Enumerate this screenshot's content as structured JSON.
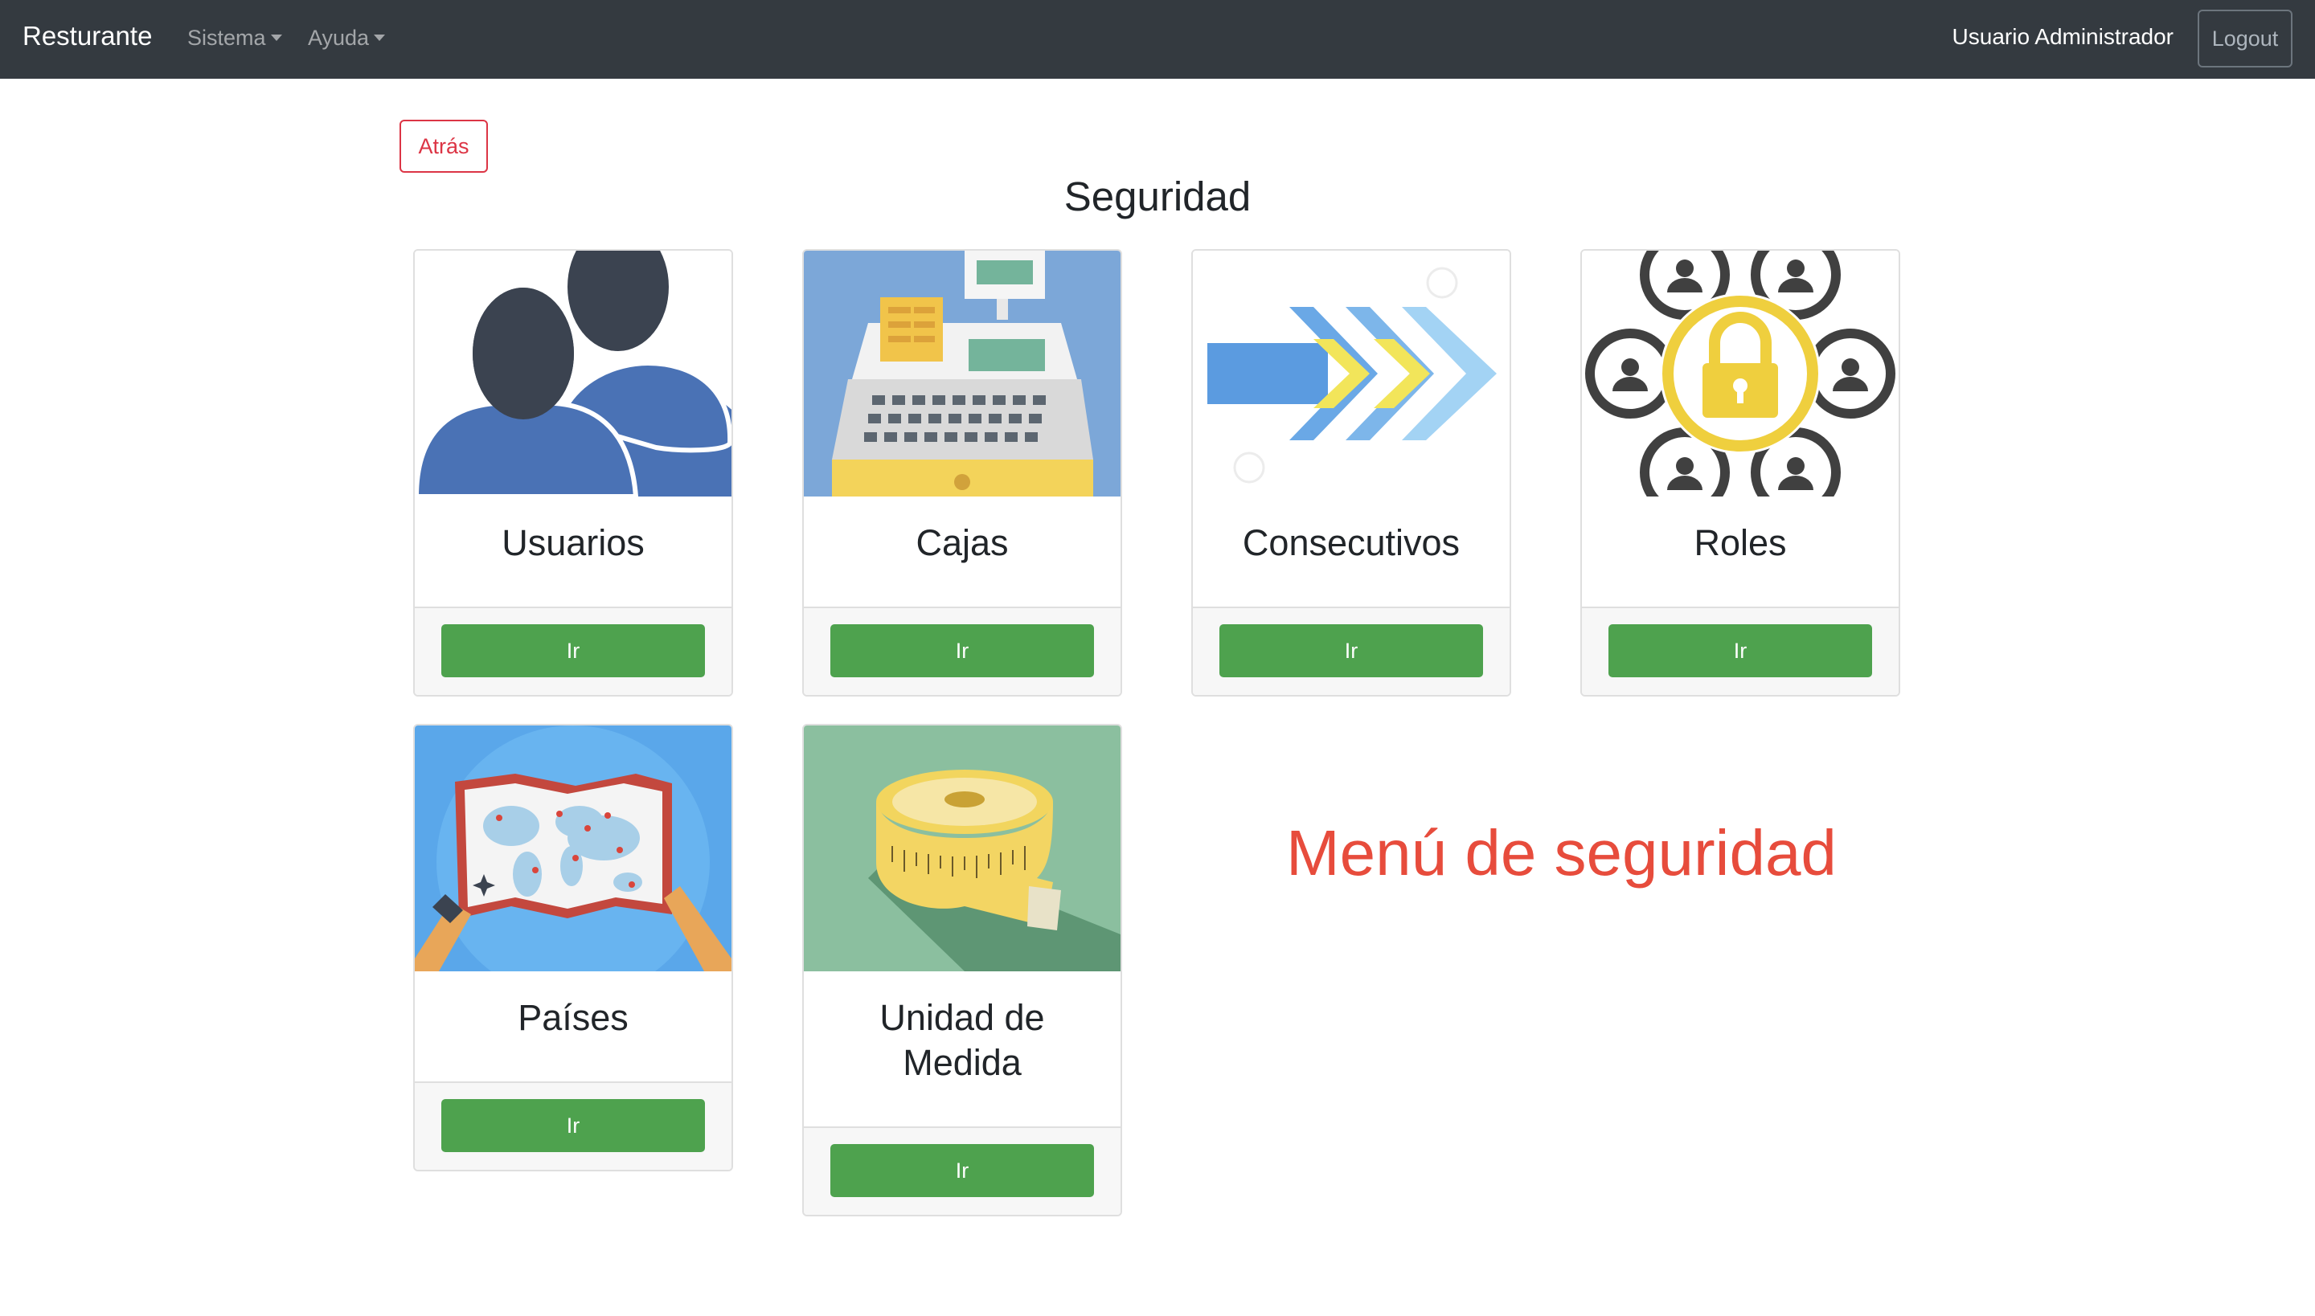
{
  "navbar": {
    "brand": "Resturante",
    "menus": [
      {
        "label": "Sistema"
      },
      {
        "label": "Ayuda"
      }
    ],
    "user": "Usuario Administrador",
    "logout": "Logout"
  },
  "back_button": "Atrás",
  "page_title": "Seguridad",
  "cards": [
    {
      "title": "Usuarios",
      "button": "Ir",
      "image": "users-icon"
    },
    {
      "title": "Cajas",
      "button": "Ir",
      "image": "cash-register-icon"
    },
    {
      "title": "Consecutivos",
      "button": "Ir",
      "image": "arrows-icon"
    },
    {
      "title": "Roles",
      "button": "Ir",
      "image": "roles-lock-icon"
    },
    {
      "title": "Países",
      "button": "Ir",
      "image": "world-map-icon"
    },
    {
      "title": "Unidad de Medida",
      "button": "Ir",
      "image": "tape-measure-icon"
    }
  ],
  "caption": "Menú de seguridad",
  "colors": {
    "navbar": "#343a40",
    "danger": "#dc3545",
    "success": "#4ea24e",
    "caption": "#e74c3c"
  }
}
